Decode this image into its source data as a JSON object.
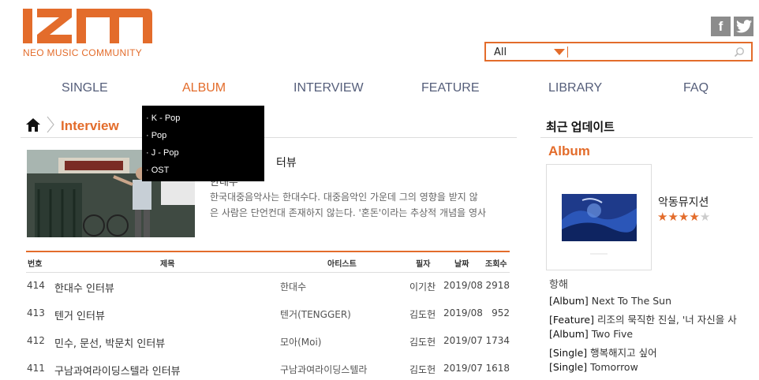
{
  "brand": {
    "logo_text": "IZM",
    "tagline": "NEO MUSIC COMMUNITY",
    "accent": "#e36c2b",
    "nav_color": "#555e7a"
  },
  "social": [
    {
      "name": "facebook",
      "glyph": "f"
    },
    {
      "name": "twitter",
      "glyph": "t"
    }
  ],
  "search": {
    "category": "All",
    "value": "",
    "placeholder": ""
  },
  "nav": {
    "items": [
      "SINGLE",
      "ALBUM",
      "INTERVIEW",
      "FEATURE",
      "LIBRARY",
      "FAQ"
    ],
    "active": "ALBUM"
  },
  "dropdown": {
    "items": [
      "· K - Pop",
      "· Pop",
      "· J - Pop",
      "· OST"
    ]
  },
  "breadcrumb": {
    "title": "Interview"
  },
  "feature": {
    "title": "터뷰",
    "artist": "한대수",
    "desc_line1": "한국대중음악사는 한대수다. 대중음악인 가운데 그의 영향을 받지 않",
    "desc_line2": "은 사람은 단언컨대 존재하지 않는다. '혼돈'이라는 추상적 개념을 영사"
  },
  "table": {
    "headers": {
      "no": "번호",
      "title": "제목",
      "artist": "아티스트",
      "writer": "필자",
      "date": "날짜",
      "views": "조회수"
    },
    "rows": [
      {
        "no": "414",
        "title": "한대수 인터뷰",
        "artist": "한대수",
        "writer": "이기찬",
        "date": "2019/08",
        "views": "2918"
      },
      {
        "no": "413",
        "title": "텐거 인터뷰",
        "artist": "텐거(TENGGER)",
        "writer": "김도헌",
        "date": "2019/08",
        "views": "952"
      },
      {
        "no": "412",
        "title": "민수, 문선, 박문치 인터뷰",
        "artist": "모아(Moi)",
        "writer": "김도헌",
        "date": "2019/07",
        "views": "1734"
      },
      {
        "no": "411",
        "title": "구남과여라이딩스텔라 인터뷰",
        "artist": "구남과여라이딩스텔라",
        "writer": "김도헌",
        "date": "2019/07",
        "views": "1618"
      }
    ]
  },
  "sidebar": {
    "heading": "최근 업데이트",
    "section": "Album",
    "album": {
      "name": "악동뮤지션",
      "rating": 4,
      "rating_max": 5,
      "title": "항해"
    },
    "updates": [
      {
        "cat": "[Album]",
        "text": " Next To The Sun"
      },
      {
        "cat": "[Feature]",
        "text": " 리조의 묵직한 진실, '너 자신을 사"
      },
      {
        "cat": "[Album]",
        "text": " Two Five"
      },
      {
        "cat": "[Single]",
        "text": " 행복해지고 싶어"
      },
      {
        "cat": "[Single]",
        "text": " Tomorrow"
      }
    ]
  }
}
